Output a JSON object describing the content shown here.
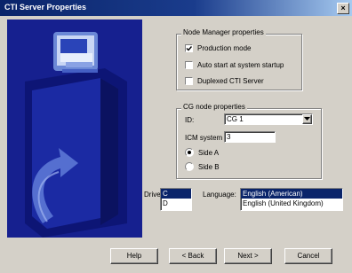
{
  "window": {
    "title": "CTI Server Properties",
    "close_glyph": "×"
  },
  "node_manager": {
    "title": "Node Manager properties",
    "items": [
      {
        "label": "Production mode",
        "checked": true
      },
      {
        "label": "Auto start at system startup",
        "checked": false
      },
      {
        "label": "Duplexed CTI Server",
        "checked": false
      }
    ]
  },
  "cg_node": {
    "title": "CG node properties",
    "id_label": "ID:",
    "id_value": "CG 1",
    "icm_label": "ICM system ID:",
    "icm_value": "3",
    "side_a": "Side A",
    "side_b": "Side B",
    "selected_side": "Side A"
  },
  "drive": {
    "label": "Drive:",
    "options": [
      "C",
      "D"
    ],
    "selected": "C"
  },
  "language": {
    "label": "Language:",
    "options": [
      "English (American)",
      "English (United Kingdom)"
    ],
    "selected": "English (American)"
  },
  "buttons": {
    "help": "Help",
    "back": "< Back",
    "next": "Next >",
    "cancel": "Cancel"
  },
  "icons": {
    "illustration": "server-computer-icon",
    "dropdown": "chevron-down-icon"
  }
}
